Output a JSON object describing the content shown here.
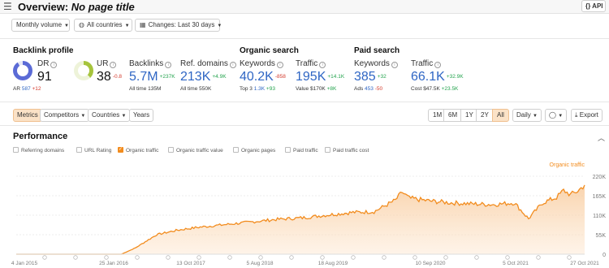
{
  "topbar": {
    "title_prefix": "Overview:",
    "title_value": "No page title",
    "api_label": "API"
  },
  "filters": {
    "volume": "Monthly volume",
    "countries": "All countries",
    "changes": "Changes: Last 30 days"
  },
  "backlink": {
    "title": "Backlink profile",
    "dr_label": "DR",
    "dr_value": "91",
    "ar_label": "AR",
    "ar_value": "587",
    "ar_delta": "+12",
    "ur_label": "UR",
    "ur_value": "38",
    "ur_delta": "-0.8",
    "backlinks_label": "Backlinks",
    "backlinks_value": "5.7M",
    "backlinks_delta": "+237K",
    "backlinks_sub_label": "All time",
    "backlinks_sub_value": "135M",
    "refdomains_label": "Ref. domains",
    "refdomains_value": "213K",
    "refdomains_delta": "+4.9K",
    "refdomains_sub_label": "All time",
    "refdomains_sub_value": "550K",
    "dr_fill": 0.91,
    "ur_fill": 0.38
  },
  "organic": {
    "title": "Organic search",
    "keywords_label": "Keywords",
    "keywords_value": "40.2K",
    "keywords_delta": "-858",
    "top3_label": "Top 3",
    "top3_value": "1.3K",
    "top3_delta": "+93",
    "traffic_label": "Traffic",
    "traffic_value": "195K",
    "traffic_delta": "+14.1K",
    "value_label": "Value",
    "value_value": "$170K",
    "value_delta": "+8K"
  },
  "paid": {
    "title": "Paid search",
    "keywords_label": "Keywords",
    "keywords_value": "385",
    "keywords_delta": "+32",
    "ads_label": "Ads",
    "ads_value": "453",
    "ads_delta": "-50",
    "traffic_label": "Traffic",
    "traffic_value": "66.1K",
    "traffic_delta": "+32.9K",
    "cost_label": "Cost",
    "cost_value": "$47.5K",
    "cost_delta": "+23.5K"
  },
  "tabs": {
    "metrics": "Metrics",
    "competitors": "Competitors",
    "countries": "Countries",
    "years": "Years"
  },
  "ranges": [
    "1M",
    "6M",
    "1Y",
    "2Y",
    "All"
  ],
  "active_range": "All",
  "granularity": "Daily",
  "export_label": "Export",
  "performance": {
    "title": "Performance",
    "toggles": [
      {
        "label": "Referring domains",
        "on": false
      },
      {
        "label": "URL Rating",
        "on": false
      },
      {
        "label": "Organic traffic",
        "on": true
      },
      {
        "label": "Organic traffic value",
        "on": false
      },
      {
        "label": "Organic pages",
        "on": false
      },
      {
        "label": "Paid traffic",
        "on": false
      },
      {
        "label": "Paid traffic cost",
        "on": false
      }
    ]
  },
  "chart_data": {
    "type": "area",
    "series": [
      {
        "name": "Organic traffic",
        "color": "#f28c1e"
      }
    ],
    "x_ticks": [
      "4 Jan 2015",
      "25 Jan 2016",
      "13 Oct 2017",
      "5 Aug 2018",
      "18 Aug 2019",
      "10 Sep 2020",
      "5 Oct 2021",
      "27 Oct 2021"
    ],
    "y_ticks": [
      "220K",
      "165K",
      "110K",
      "55K",
      "0"
    ],
    "ylim": [
      0,
      220000
    ],
    "points": [
      [
        "2015-01",
        0
      ],
      [
        "2015-06",
        0
      ],
      [
        "2015-12",
        0
      ],
      [
        "2016-04",
        0
      ],
      [
        "2016-06",
        18000
      ],
      [
        "2016-09",
        55000
      ],
      [
        "2016-12",
        68000
      ],
      [
        "2017-03",
        76000
      ],
      [
        "2017-06",
        82000
      ],
      [
        "2017-10",
        90000
      ],
      [
        "2018-02",
        98000
      ],
      [
        "2018-06",
        103000
      ],
      [
        "2018-10",
        112000
      ],
      [
        "2019-01",
        118000
      ],
      [
        "2019-04",
        120000
      ],
      [
        "2019-07",
        152000
      ],
      [
        "2019-08",
        175000
      ],
      [
        "2019-09",
        158000
      ],
      [
        "2019-12",
        150000
      ],
      [
        "2020-03",
        145000
      ],
      [
        "2020-06",
        142000
      ],
      [
        "2020-09",
        140000
      ],
      [
        "2020-12",
        145000
      ],
      [
        "2021-02",
        100000
      ],
      [
        "2021-04",
        145000
      ],
      [
        "2021-06",
        160000
      ],
      [
        "2021-07",
        180000
      ],
      [
        "2021-08",
        168000
      ],
      [
        "2021-09",
        178000
      ],
      [
        "2021-10",
        195000
      ]
    ],
    "grid": true
  }
}
